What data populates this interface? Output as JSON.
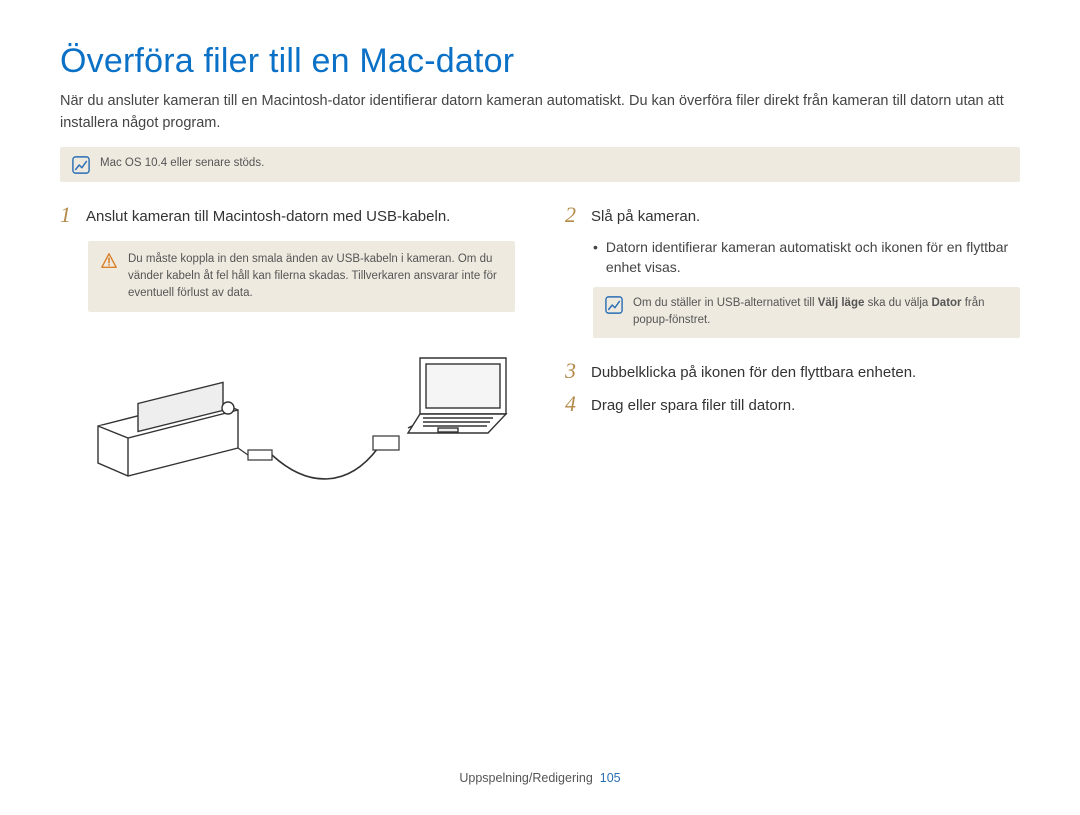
{
  "title": "Överföra filer till en Mac-dator",
  "intro": "När du ansluter kameran till en Macintosh-dator identifierar datorn kameran automatiskt. Du kan överföra filer direkt från kameran till datorn utan att installera något program.",
  "top_note": "Mac OS 10.4 eller senare stöds.",
  "left": {
    "step1_num": "1",
    "step1_text": "Anslut kameran till Macintosh-datorn med USB-kabeln.",
    "warn_text": "Du måste koppla in den smala änden av USB-kabeln i kameran. Om du vänder kabeln åt fel håll kan filerna skadas. Tillverkaren ansvarar inte för eventuell förlust av data."
  },
  "right": {
    "step2_num": "2",
    "step2_text": "Slå på kameran.",
    "step2_bullet": "Datorn identifierar kameran automatiskt och ikonen för en flyttbar enhet visas.",
    "info_prefix": "Om du ställer in USB-alternativet till ",
    "info_bold1": "Välj läge",
    "info_mid": " ska du välja ",
    "info_bold2": "Dator",
    "info_suffix": " från popup-fönstret.",
    "step3_num": "3",
    "step3_text": "Dubbelklicka på ikonen för den flyttbara enheten.",
    "step4_num": "4",
    "step4_text": "Drag eller spara filer till datorn."
  },
  "footer_section": "Uppspelning/Redigering",
  "footer_page": "105"
}
